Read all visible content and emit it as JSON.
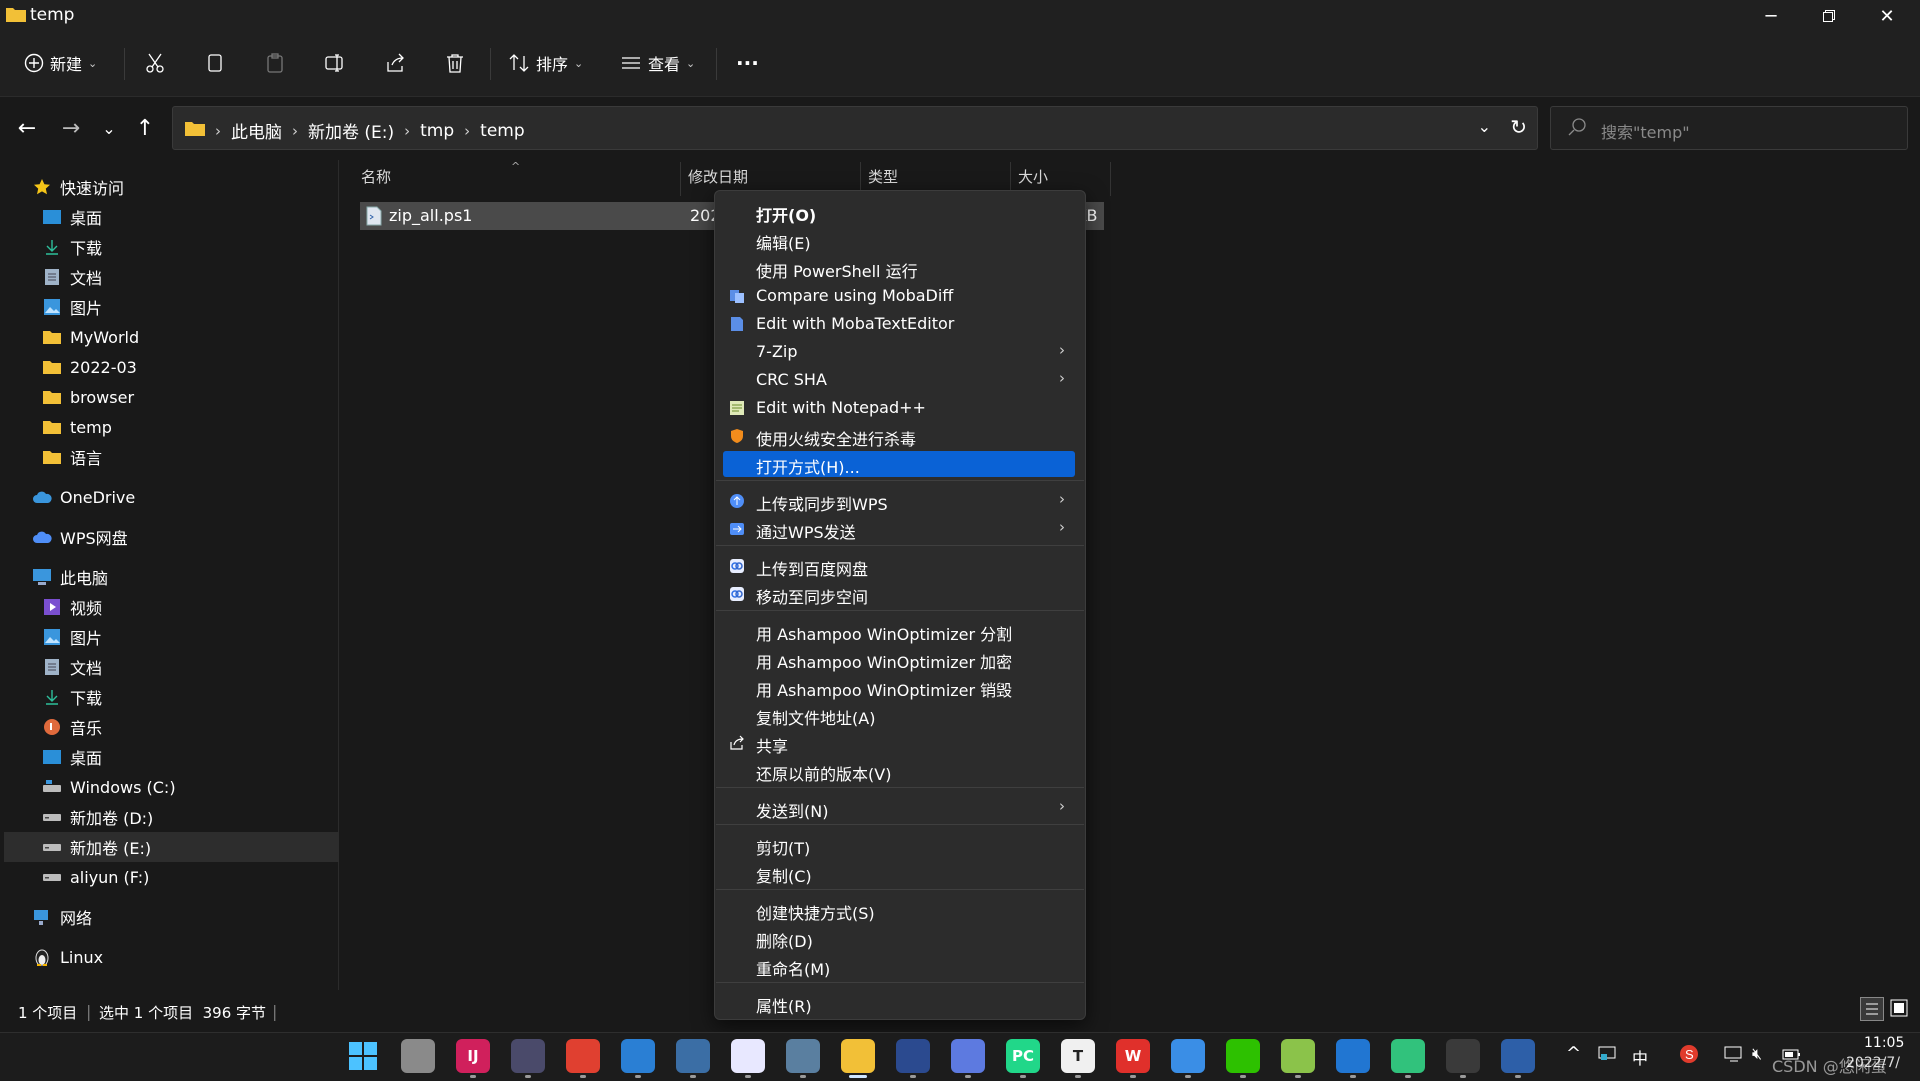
{
  "window": {
    "title": "temp"
  },
  "toolbar": {
    "new_label": "新建",
    "sort_label": "排序",
    "view_label": "查看",
    "more_label": "···"
  },
  "address": {
    "crumbs": [
      "此电脑",
      "新加卷 (E:)",
      "tmp",
      "temp"
    ],
    "search_placeholder": "搜索\"temp\""
  },
  "sidebar": {
    "quick_access": "快速访问",
    "quick_items": [
      {
        "label": "桌面",
        "pinned": true
      },
      {
        "label": "下载",
        "pinned": true
      },
      {
        "label": "文档",
        "pinned": true
      },
      {
        "label": "图片",
        "pinned": true
      },
      {
        "label": "MyWorld",
        "pinned": true
      },
      {
        "label": "2022-03"
      },
      {
        "label": "browser"
      },
      {
        "label": "temp"
      },
      {
        "label": "语言"
      }
    ],
    "onedrive": "OneDrive",
    "wps": "WPS网盘",
    "this_pc": "此电脑",
    "pc_items": [
      {
        "label": "视频"
      },
      {
        "label": "图片"
      },
      {
        "label": "文档"
      },
      {
        "label": "下载"
      },
      {
        "label": "音乐"
      },
      {
        "label": "桌面"
      },
      {
        "label": "Windows (C:)"
      },
      {
        "label": "新加卷 (D:)"
      },
      {
        "label": "新加卷 (E:)",
        "selected": true
      },
      {
        "label": "aliyun (F:)"
      }
    ],
    "network": "网络",
    "linux": "Linux"
  },
  "columns": {
    "name": "名称",
    "date": "修改日期",
    "type": "类型",
    "size": "大小"
  },
  "files": [
    {
      "name": "zip_all.ps1",
      "date": "202",
      "size": "KB"
    }
  ],
  "status": {
    "count": "1 个项目",
    "selection": "选中 1 个项目  396 字节"
  },
  "context_menu": {
    "groups": [
      [
        {
          "label": "打开(O)",
          "bold": true
        },
        {
          "label": "编辑(E)"
        },
        {
          "label": "使用 PowerShell 运行"
        },
        {
          "label": "Compare using MobaDiff",
          "icon": "mobadiff-icon"
        },
        {
          "label": "Edit with MobaTextEditor",
          "icon": "mobatexteditor-icon"
        },
        {
          "label": "7-Zip",
          "submenu": true
        },
        {
          "label": "CRC SHA",
          "submenu": true
        },
        {
          "label": "Edit with Notepad++",
          "icon": "notepadpp-icon"
        },
        {
          "label": "使用火绒安全进行杀毒",
          "icon": "huorong-shield-icon"
        },
        {
          "label": "打开方式(H)...",
          "highlighted": true
        }
      ],
      [
        {
          "label": "上传或同步到WPS",
          "icon": "wps-cloud-icon",
          "submenu": true
        },
        {
          "label": "通过WPS发送",
          "icon": "wps-send-icon",
          "submenu": true
        }
      ],
      [
        {
          "label": "上传到百度网盘",
          "icon": "baidu-netdisk-icon"
        },
        {
          "label": "移动至同步空间",
          "icon": "baidu-sync-icon"
        }
      ],
      [
        {
          "label": "用 Ashampoo WinOptimizer 分割"
        },
        {
          "label": "用 Ashampoo WinOptimizer 加密"
        },
        {
          "label": "用 Ashampoo WinOptimizer 销毁"
        },
        {
          "label": "复制文件地址(A)"
        },
        {
          "label": "共享",
          "icon": "share-icon"
        },
        {
          "label": "还原以前的版本(V)"
        }
      ],
      [
        {
          "label": "发送到(N)",
          "submenu": true
        }
      ],
      [
        {
          "label": "剪切(T)"
        },
        {
          "label": "复制(C)"
        }
      ],
      [
        {
          "label": "创建快捷方式(S)"
        },
        {
          "label": "删除(D)"
        },
        {
          "label": "重命名(M)"
        }
      ],
      [
        {
          "label": "属性(R)"
        }
      ]
    ]
  },
  "taskbar": {
    "apps": [
      {
        "name": "windows-start-icon",
        "text": "",
        "color": "#1e90ff"
      },
      {
        "name": "task-view-icon",
        "text": "",
        "color": "#8a8a8a"
      },
      {
        "name": "intellij-idea-icon",
        "text": "IJ",
        "color": "#d0205c"
      },
      {
        "name": "password-manager-icon",
        "text": "",
        "color": "#4a4a6a"
      },
      {
        "name": "chrome-icon",
        "text": "",
        "color": "#e04030"
      },
      {
        "name": "photos-icon",
        "text": "",
        "color": "#2a7fd4"
      },
      {
        "name": "snipping-tool-icon",
        "text": "",
        "color": "#3b6ea5"
      },
      {
        "name": "baidu-netdisk-icon",
        "text": "",
        "color": "#e8e8ff"
      },
      {
        "name": "image-viewer-icon",
        "text": "",
        "color": "#5a7fa0"
      },
      {
        "name": "file-explorer-icon",
        "text": "",
        "color": "#f2c037"
      },
      {
        "name": "feishu-icon",
        "text": "",
        "color": "#2b4a8f"
      },
      {
        "name": "cursor-app-icon",
        "text": "",
        "color": "#5d7ae0"
      },
      {
        "name": "pycharm-icon",
        "text": "PC",
        "color": "#21d789"
      },
      {
        "name": "typora-icon",
        "text": "T",
        "color": "#f0f0f0"
      },
      {
        "name": "wps-office-icon",
        "text": "W",
        "color": "#e0302b"
      },
      {
        "name": "lark-icon",
        "text": "",
        "color": "#3a8ee6"
      },
      {
        "name": "wechat-icon",
        "text": "",
        "color": "#2dc100"
      },
      {
        "name": "notepadpp-icon",
        "text": "",
        "color": "#8bc34a"
      },
      {
        "name": "edge-dev-icon",
        "text": "",
        "color": "#2176d2"
      },
      {
        "name": "qq-music-icon",
        "text": "",
        "color": "#31c27c"
      },
      {
        "name": "terminal-icon",
        "text": "",
        "color": "#3a3a3a"
      },
      {
        "name": "powershell-icon",
        "text": "",
        "color": "#2d5fa8"
      }
    ],
    "tray": {
      "ime": "中",
      "time": "11:05",
      "date": "2022/7/",
      "watermark": "CSDN @悠闲蛋"
    }
  }
}
